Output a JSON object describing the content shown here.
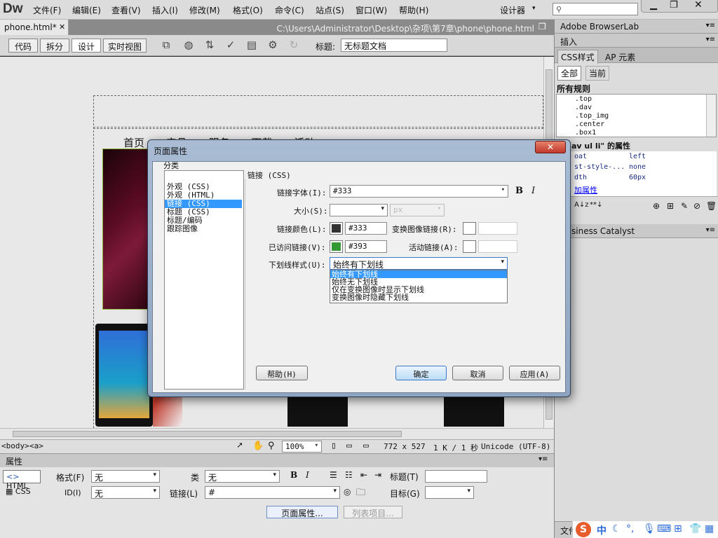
{
  "app": {
    "logo": "Dw"
  },
  "menu": [
    "文件(F)",
    "编辑(E)",
    "查看(V)",
    "插入(I)",
    "修改(M)",
    "格式(O)",
    "命令(C)",
    "站点(S)",
    "窗口(W)",
    "帮助(H)"
  ],
  "workspace": "设计器",
  "document": {
    "tab": "phone.html*",
    "path": "C:\\Users\\Administrator\\Desktop\\杂项\\第7章\\phone\\phone.html"
  },
  "toolbar": {
    "views": [
      "代码",
      "拆分",
      "设计",
      "实时视图"
    ],
    "title_label": "标题:",
    "title_value": "无标题文档"
  },
  "page_nav": [
    "首页",
    "产品",
    "服务",
    "下载",
    "活动"
  ],
  "status": {
    "tags": [
      "<body>",
      "<a>"
    ],
    "zoom": "100%",
    "dims": "772 x 527",
    "size": "1 K / 1 秒",
    "encoding": "Unicode (UTF-8)"
  },
  "properties": {
    "header": "属性",
    "html_btn": "HTML",
    "css_btn": "CSS",
    "format_label": "格式(F)",
    "format_value": "无",
    "class_label": "类",
    "class_value": "无",
    "id_label": "ID(I)",
    "id_value": "无",
    "link_label": "链接(L)",
    "link_value": "#",
    "title_label": "标题(T)",
    "target_label": "目标(G)",
    "page_props_btn": "页面属性...",
    "list_items_btn": "列表项目..."
  },
  "right_panel": {
    "browserlab": "Adobe BrowserLab",
    "insert": "插入",
    "css_tab": "CSS样式",
    "ap_tab": "AP 元素",
    "all_btn": "全部",
    "current_btn": "当前",
    "all_rules": "所有规则",
    "rules": [
      ".top",
      ".dav",
      ".top_img",
      ".center",
      ".box1"
    ],
    "props_title": "av ul li\" 的属性",
    "props_rows": [
      [
        "oat",
        "left"
      ],
      [
        "st-style-...",
        "none"
      ],
      [
        "dth",
        "60px"
      ]
    ],
    "add_property": "加属性",
    "business_catalyst": "siness Catalyst",
    "files": "文件"
  },
  "dialog": {
    "title": "页面属性",
    "category_label": "分类",
    "categories": [
      "外观 (CSS)",
      "外观 (HTML)",
      "链接 (CSS)",
      "标题 (CSS)",
      "标题/编码",
      "跟踪图像"
    ],
    "selected_category": 2,
    "section": "链接 (CSS)",
    "link_font_label": "链接字体(I):",
    "link_font_value": "#333",
    "size_label": "大小(S):",
    "size_unit": "px",
    "link_color_label": "链接颜色(L):",
    "link_color_value": "#333",
    "rollover_label": "变换图像链接(R):",
    "visited_label": "已访问链接(V):",
    "visited_value": "#393",
    "active_label": "活动链接(A):",
    "underline_label": "下划线样式(U):",
    "underline_value": "始终有下划线",
    "underline_options": [
      "始终有下划线",
      "始终无下划线",
      "仅在变换图像时显示下划线",
      "变换图像时隐藏下划线"
    ],
    "help_btn": "帮助(H)",
    "ok_btn": "确定",
    "cancel_btn": "取消",
    "apply_btn": "应用(A)",
    "bold": "B",
    "italic": "I"
  },
  "colors": {
    "link": "#333333",
    "visited": "#339933",
    "selection": "#3399ff"
  }
}
